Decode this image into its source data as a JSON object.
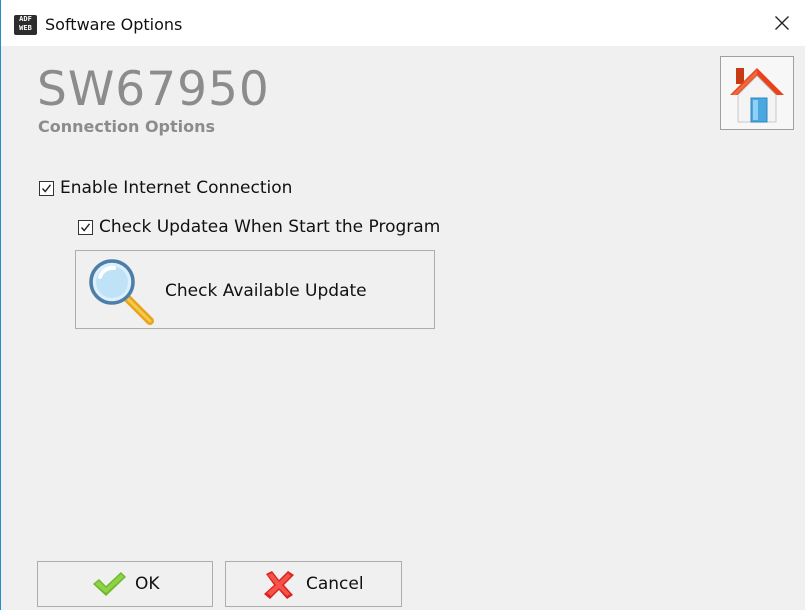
{
  "window": {
    "title": "Software Options",
    "app_icon_line1": "ADF",
    "app_icon_line2": "WEB"
  },
  "header": {
    "product_code": "SW67950",
    "subtitle": "Connection Options"
  },
  "options": {
    "enable_internet": {
      "label": "Enable Internet Connection",
      "checked": true
    },
    "check_on_start": {
      "label": "Check Updatea When Start the Program",
      "checked": true
    }
  },
  "update_button": {
    "label": "Check Available Update"
  },
  "footer": {
    "ok_label": "OK",
    "cancel_label": "Cancel"
  },
  "colors": {
    "window_border": "#1e90d0",
    "background": "#f0f0f0",
    "product_text": "#8c8c8c",
    "ok_check": "#6dbb2a",
    "cancel_x": "#e0201e",
    "home_roof": "#e8431c"
  }
}
